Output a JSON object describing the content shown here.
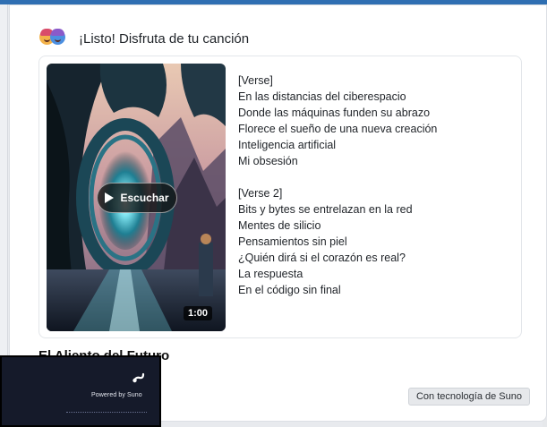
{
  "header": {
    "text": "¡Listo! Disfruta de tu canción",
    "avatar_icon": "users-avatar-icon"
  },
  "player": {
    "listen_label": "Escuchar",
    "duration": "1:00"
  },
  "lyrics": {
    "verse1": [
      "[Verse]",
      "En las distancias del ciberespacio",
      "Donde las máquinas funden su abrazo",
      "Florece el sueño de una nueva creación",
      "Inteligencia artificial",
      "Mi obsesión"
    ],
    "verse2": [
      "[Verse 2]",
      "Bits y bytes se entrelazan en la red",
      "Mentes de silicio",
      "Pensamientos sin piel",
      "¿Quién dirá si el corazón es real?",
      "La respuesta",
      "En el código sin final"
    ]
  },
  "song": {
    "title": "El Aliento del Futuro"
  },
  "badge": {
    "label": "Con tecnología de Suno"
  },
  "overlay": {
    "text": "Powered by Suno"
  },
  "colors": {
    "accent_bar": "#2f6fb2",
    "card_bg": "#ffffff",
    "overlay_bg": "#151a2a"
  }
}
